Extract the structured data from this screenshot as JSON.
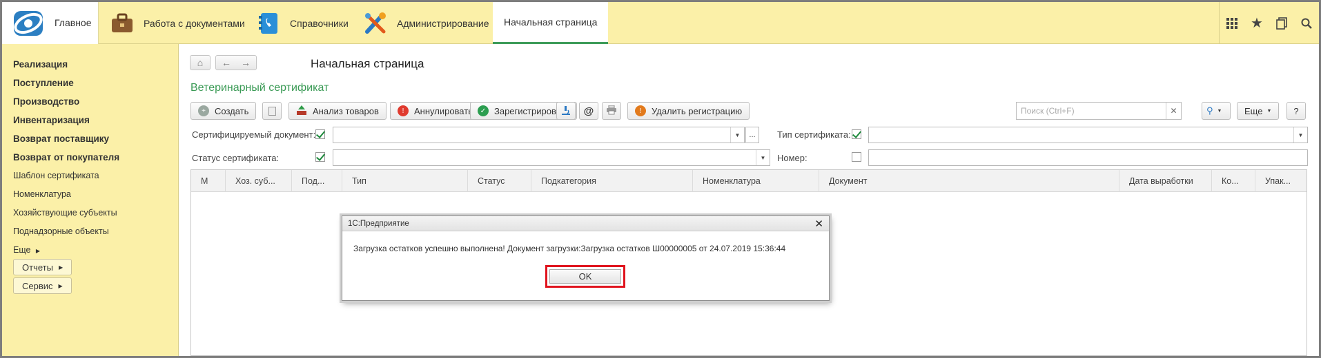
{
  "top": {
    "home": "Главное",
    "docs": "Работа с документами",
    "refs": "Справочники",
    "admin": "Администрирование",
    "active_tab": "Начальная страница"
  },
  "sidebar": {
    "items": [
      "Реализация",
      "Поступление",
      "Производство",
      "Инвентаризация",
      "Возврат поставщику",
      "Возврат от покупателя",
      "Шаблон сертификата",
      "Номенклатура",
      "Хозяйствующие субъекты",
      "Поднадзорные объекты",
      "Еще"
    ],
    "reports": "Отчеты",
    "service": "Сервис"
  },
  "page": {
    "title": "Начальная страница",
    "form_title": "Ветеринарный сертификат"
  },
  "toolbar": {
    "create": "Создать",
    "analysis": "Анализ товаров",
    "annul": "Аннулировать",
    "register": "Зарегистрировать",
    "at": "@",
    "delete_reg": "Удалить регистрацию",
    "search_placeholder": "Поиск (Ctrl+F)",
    "more": "Еще",
    "help": "?"
  },
  "filters": {
    "cert_doc": "Сертифицируемый документ:",
    "cert_type": "Тип сертификата:",
    "cert_status": "Статус сертификата:",
    "number": "Номер:"
  },
  "table": {
    "columns": [
      "М",
      "Хоз. суб...",
      "Под...",
      "Тип",
      "Статус",
      "Подкатегория",
      "Номенклатура",
      "Документ",
      "Дата выработки",
      "Ко...",
      "Упак..."
    ]
  },
  "dialog": {
    "title": "1С:Предприятие",
    "message": "Загрузка остатков успешно выполнена! Документ загрузки:Загрузка остатков Ш00000005 от 24.07.2019 15:36:44",
    "ok": "OK"
  },
  "colors": {
    "accent_green": "#3a9a55",
    "panel_yellow": "#fbf0a8",
    "highlight_red": "#e0141e"
  },
  "icons": [
    "app-logo-icon",
    "briefcase-icon",
    "phonebook-icon",
    "tools-icon",
    "grid-icon",
    "star-icon",
    "history-icon",
    "search-icon"
  ]
}
